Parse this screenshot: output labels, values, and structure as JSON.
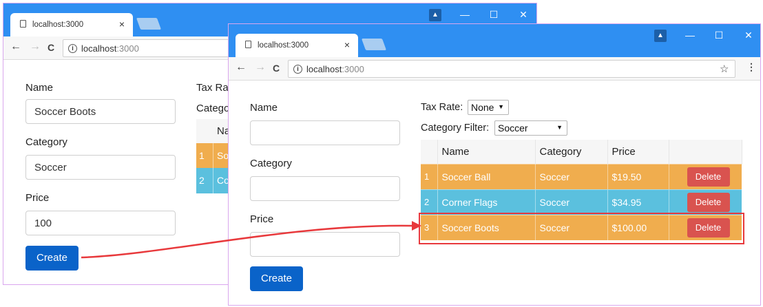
{
  "browser": {
    "tab_title": "localhost:3000",
    "tab_close": "×",
    "url_host": "localhost",
    "url_port": ":3000",
    "info_glyph": "i",
    "back_glyph": "←",
    "forward_glyph": "→",
    "reload_glyph": "C",
    "minimize_glyph": "—",
    "maximize_glyph": "☐",
    "close_glyph": "✕",
    "profile_glyph": "▲",
    "star_glyph": "☆",
    "menu_glyph": "⋮",
    "icons": [
      "page-icon",
      "back-icon",
      "forward-icon",
      "reload-icon",
      "info-icon",
      "star-icon",
      "menu-icon",
      "profile-icon",
      "minimize-icon",
      "maximize-icon",
      "close-icon"
    ]
  },
  "back_window": {
    "form": {
      "name_label": "Name",
      "name_value": "Soccer Boots",
      "category_label": "Category",
      "category_value": "Soccer",
      "price_label": "Price",
      "price_value": "100",
      "create_label": "Create"
    },
    "tax_label_clipped": "Tax Ra",
    "category_label_clipped": "Catego",
    "table": {
      "header_clipped": "Na",
      "rows": [
        {
          "num": "1",
          "text": "So"
        },
        {
          "num": "2",
          "text": "Co"
        }
      ]
    }
  },
  "front_window": {
    "form": {
      "name_label": "Name",
      "name_value": "",
      "category_label": "Category",
      "category_value": "",
      "price_label": "Price",
      "price_value": "",
      "create_label": "Create"
    },
    "tax_rate_label": "Tax Rate:",
    "tax_rate_value": "None",
    "category_filter_label": "Category Filter:",
    "category_filter_value": "Soccer",
    "dropdown_glyph": "▼",
    "table": {
      "headers": [
        "",
        "Name",
        "Category",
        "Price",
        ""
      ],
      "rows": [
        {
          "num": "1",
          "name": "Soccer Ball",
          "category": "Soccer",
          "price": "$19.50",
          "action": "Delete",
          "color": "#f0ad4e"
        },
        {
          "num": "2",
          "name": "Corner Flags",
          "category": "Soccer",
          "price": "$34.95",
          "action": "Delete",
          "color": "#5bc0de"
        },
        {
          "num": "3",
          "name": "Soccer Boots",
          "category": "Soccer",
          "price": "$100.00",
          "action": "Delete",
          "color": "#f0ad4e"
        }
      ]
    }
  },
  "colors": {
    "titlebar": "#2f8ff2",
    "primary_button": "#0a63c9",
    "delete_button": "#d9534f",
    "row_warning": "#f0ad4e",
    "row_info": "#5bc0de",
    "annotation": "#e8393c"
  }
}
